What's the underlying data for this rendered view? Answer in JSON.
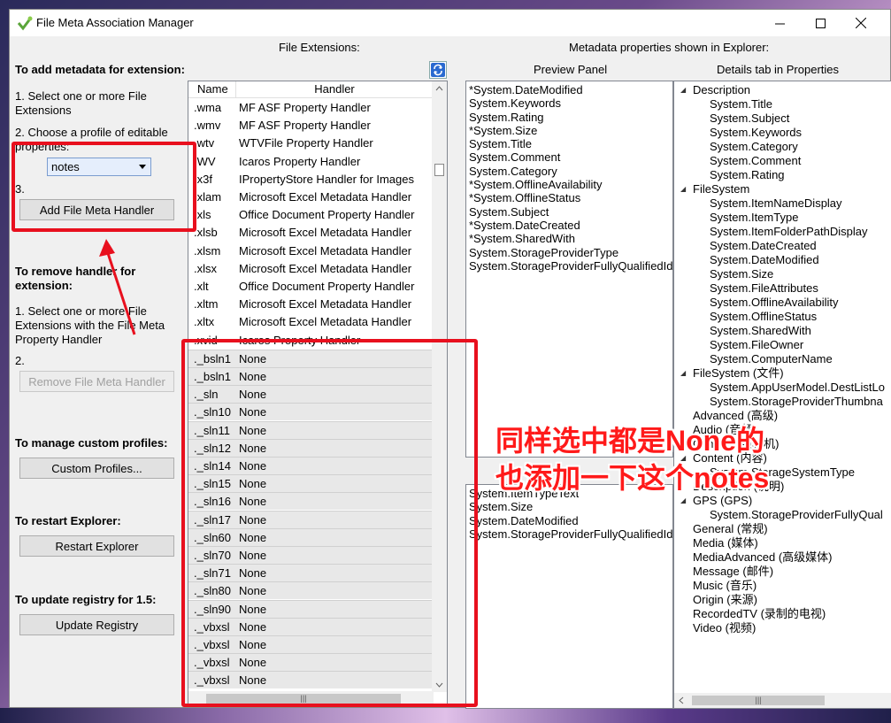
{
  "window": {
    "title": "File Meta Association Manager"
  },
  "left": {
    "add_heading": "To add metadata for extension:",
    "step1": "1. Select one or more File Extensions",
    "step2": "2. Choose a profile of editable properties:",
    "profile_value": "notes",
    "step3": "3.",
    "add_button": "Add File Meta Handler",
    "remove_heading": "To remove handler for extension:",
    "remove_step1": "1. Select one or more File Extensions with the File Meta Property Handler",
    "remove_step2": "2.",
    "remove_button": "Remove File Meta Handler",
    "custom_heading": "To manage custom profiles:",
    "custom_button": "Custom Profiles...",
    "restart_heading": "To restart Explorer:",
    "restart_button": "Restart Explorer",
    "registry_heading": "To update registry for 1.5:",
    "registry_button": "Update Registry"
  },
  "extensions": {
    "heading": "File Extensions:",
    "col_name": "Name",
    "col_handler": "Handler",
    "rows": [
      {
        "name": ".wma",
        "handler": "MF ASF Property Handler"
      },
      {
        "name": ".wmv",
        "handler": "MF ASF Property Handler"
      },
      {
        "name": ".wtv",
        "handler": "WTVFile Property Handler"
      },
      {
        "name": ".WV",
        "handler": "Icaros Property Handler"
      },
      {
        "name": ".x3f",
        "handler": "IPropertyStore Handler for Images"
      },
      {
        "name": ".xlam",
        "handler": "Microsoft Excel Metadata Handler"
      },
      {
        "name": ".xls",
        "handler": "Office Document Property Handler"
      },
      {
        "name": ".xlsb",
        "handler": "Microsoft Excel Metadata Handler"
      },
      {
        "name": ".xlsm",
        "handler": "Microsoft Excel Metadata Handler"
      },
      {
        "name": ".xlsx",
        "handler": "Microsoft Excel Metadata Handler"
      },
      {
        "name": ".xlt",
        "handler": "Office Document Property Handler"
      },
      {
        "name": ".xltm",
        "handler": "Microsoft Excel Metadata Handler"
      },
      {
        "name": ".xltx",
        "handler": "Microsoft Excel Metadata Handler"
      },
      {
        "name": ".xvid",
        "handler": "Icaros Property Handler"
      },
      {
        "name": "._bsln1",
        "handler": "None"
      },
      {
        "name": "._bsln1",
        "handler": "None"
      },
      {
        "name": "._sln",
        "handler": "None"
      },
      {
        "name": "._sln10",
        "handler": "None"
      },
      {
        "name": "._sln11",
        "handler": "None"
      },
      {
        "name": "._sln12",
        "handler": "None"
      },
      {
        "name": "._sln14",
        "handler": "None"
      },
      {
        "name": "._sln15",
        "handler": "None"
      },
      {
        "name": "._sln16",
        "handler": "None"
      },
      {
        "name": "._sln17",
        "handler": "None"
      },
      {
        "name": "._sln60",
        "handler": "None"
      },
      {
        "name": "._sln70",
        "handler": "None"
      },
      {
        "name": "._sln71",
        "handler": "None"
      },
      {
        "name": "._sln80",
        "handler": "None"
      },
      {
        "name": "._sln90",
        "handler": "None"
      },
      {
        "name": "._vbxsl",
        "handler": "None"
      },
      {
        "name": "._vbxsl",
        "handler": "None"
      },
      {
        "name": "._vbxsl",
        "handler": "None"
      },
      {
        "name": "._vbxsl",
        "handler": "None"
      }
    ]
  },
  "metadata": {
    "heading": "Metadata properties shown in Explorer:",
    "preview_heading": "Preview Panel",
    "details_heading": "Details tab in Properties",
    "preview_items": [
      "*System.DateModified",
      "System.Keywords",
      "System.Rating",
      "*System.Size",
      "System.Title",
      "System.Comment",
      "System.Category",
      "*System.OfflineAvailability",
      "*System.OfflineStatus",
      "System.Subject",
      "*System.DateCreated",
      "*System.SharedWith",
      "System.StorageProviderType",
      "System.StorageProviderFullyQualifiedId"
    ],
    "info_tip_items": [
      "System.ItemTypeText",
      "System.Size",
      "System.DateModified",
      "System.StorageProviderFullyQualifiedId"
    ],
    "details_tree": [
      {
        "label": "Description",
        "expander": true,
        "indent": 0
      },
      {
        "label": "System.Title",
        "indent": 1
      },
      {
        "label": "System.Subject",
        "indent": 1
      },
      {
        "label": "System.Keywords",
        "indent": 1
      },
      {
        "label": "System.Category",
        "indent": 1
      },
      {
        "label": "System.Comment",
        "indent": 1
      },
      {
        "label": "System.Rating",
        "indent": 1
      },
      {
        "label": "FileSystem",
        "expander": true,
        "indent": 0
      },
      {
        "label": "System.ItemNameDisplay",
        "indent": 1
      },
      {
        "label": "System.ItemType",
        "indent": 1
      },
      {
        "label": "System.ItemFolderPathDisplay",
        "indent": 1
      },
      {
        "label": "System.DateCreated",
        "indent": 1
      },
      {
        "label": "System.DateModified",
        "indent": 1
      },
      {
        "label": "System.Size",
        "indent": 1
      },
      {
        "label": "System.FileAttributes",
        "indent": 1
      },
      {
        "label": "System.OfflineAvailability",
        "indent": 1
      },
      {
        "label": "System.OfflineStatus",
        "indent": 1
      },
      {
        "label": "System.SharedWith",
        "indent": 1
      },
      {
        "label": "System.FileOwner",
        "indent": 1
      },
      {
        "label": "System.ComputerName",
        "indent": 1
      },
      {
        "label": "FileSystem (文件)",
        "expander": true,
        "indent": 0
      },
      {
        "label": "System.AppUserModel.DestListLo",
        "indent": 1
      },
      {
        "label": "System.StorageProviderThumbna",
        "indent": 1
      },
      {
        "label": "Advanced (高级)",
        "indent": 0
      },
      {
        "label": "Audio (音频)",
        "indent": 0
      },
      {
        "label": "Camera (照相机)",
        "indent": 0
      },
      {
        "label": "Content (内容)",
        "expander": true,
        "indent": 0
      },
      {
        "label": "System.StorageSystemType",
        "indent": 1
      },
      {
        "label": "Description (说明)",
        "indent": 0
      },
      {
        "label": "GPS (GPS)",
        "expander": true,
        "indent": 0
      },
      {
        "label": "System.StorageProviderFullyQual",
        "indent": 1
      },
      {
        "label": "General (常规)",
        "indent": 0
      },
      {
        "label": "Media (媒体)",
        "indent": 0
      },
      {
        "label": "MediaAdvanced (高级媒体)",
        "indent": 0
      },
      {
        "label": "Message (邮件)",
        "indent": 0
      },
      {
        "label": "Music (音乐)",
        "indent": 0
      },
      {
        "label": "Origin (来源)",
        "indent": 0
      },
      {
        "label": "RecordedTV (录制的电视)",
        "indent": 0
      },
      {
        "label": "Video (视频)",
        "indent": 0
      }
    ]
  },
  "annotation": {
    "line1": "同样选中都是None的",
    "line2": "也添加一下这个notes",
    "color": "#ff1a1a"
  }
}
